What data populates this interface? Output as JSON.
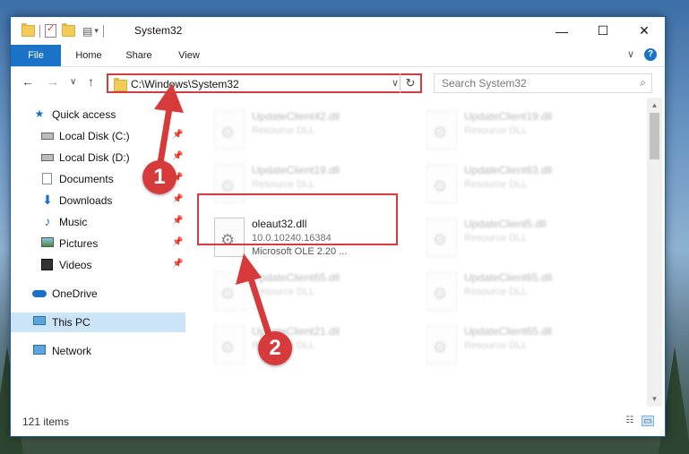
{
  "window": {
    "title": "System32",
    "controls": {
      "minimize": "—",
      "maximize": "☐",
      "close": "✕"
    }
  },
  "ribbon": {
    "tabs": [
      "File",
      "Home",
      "Share",
      "View"
    ],
    "collapse": "∨",
    "help": "?"
  },
  "navbar": {
    "back": "←",
    "forward": "→",
    "recent": "∨",
    "up": "↑",
    "address": "C:\\Windows\\System32",
    "address_dropdown": "∨",
    "refresh": "↻",
    "search_placeholder": "Search System32"
  },
  "sidebar": {
    "items": [
      {
        "label": "Quick access",
        "icon": "star-icon"
      },
      {
        "label": "Local Disk (C:)",
        "icon": "drive-icon",
        "pinned": true
      },
      {
        "label": "Local Disk (D:)",
        "icon": "drive-icon",
        "pinned": true
      },
      {
        "label": "Documents",
        "icon": "documents-icon",
        "pinned": true
      },
      {
        "label": "Downloads",
        "icon": "download-icon",
        "pinned": true
      },
      {
        "label": "Music",
        "icon": "music-icon",
        "pinned": true
      },
      {
        "label": "Pictures",
        "icon": "pictures-icon",
        "pinned": true
      },
      {
        "label": "Videos",
        "icon": "videos-icon",
        "pinned": true
      },
      {
        "label": "OneDrive",
        "icon": "cloud-icon"
      },
      {
        "label": "This PC",
        "icon": "computer-icon",
        "selected": true
      },
      {
        "label": "Network",
        "icon": "network-icon"
      }
    ]
  },
  "files": [
    {
      "name": "UpdateClient42.dll",
      "desc": "Resource DLL"
    },
    {
      "name": "UpdateClient19.dll",
      "desc": "Resource DLL"
    },
    {
      "name": "UpdateClient19.dll",
      "desc": "Resource DLL"
    },
    {
      "name": "UpdateClient63.dll",
      "desc": "Resource DLL"
    },
    {
      "name": "oleaut32.dll",
      "desc": "10.0.10240.16384",
      "desc2": "Microsoft OLE 2.20 ..."
    },
    {
      "name": "UpdateClient5.dll",
      "desc": "Resource DLL"
    },
    {
      "name": "UpdateClient65.dll",
      "desc": "Resource DLL"
    },
    {
      "name": "UpdateClient65.dll",
      "desc": "Resource DLL"
    },
    {
      "name": "UpdateClient21.dll",
      "desc": "Resource DLL"
    },
    {
      "name": "UpdateClient65.dll",
      "desc": "Resource DLL"
    }
  ],
  "status": {
    "item_count": "121 items"
  },
  "callouts": {
    "step1": "1",
    "step2": "2"
  },
  "colors": {
    "accent": "#1a73c6",
    "highlight": "#d63a3a",
    "selection": "#cce4f7"
  }
}
